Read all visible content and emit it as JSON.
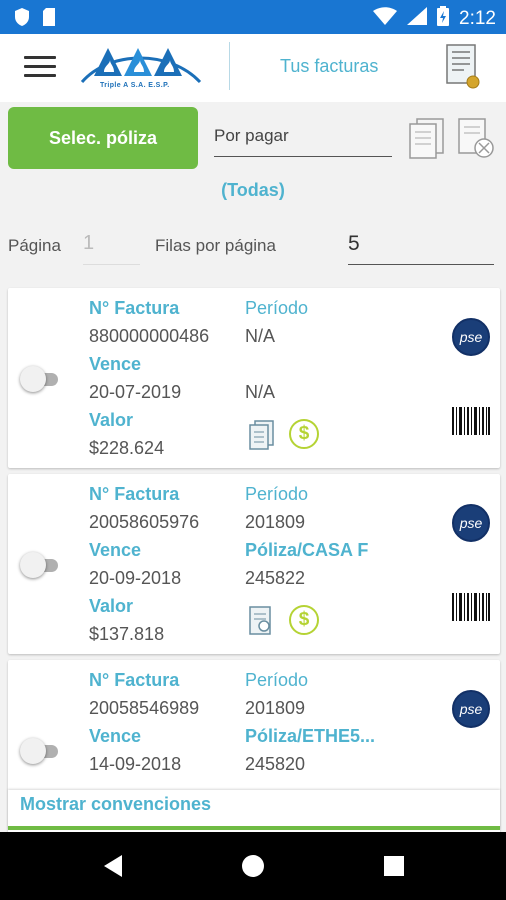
{
  "status_bar": {
    "time": "2:12"
  },
  "header": {
    "logo_caption": "Triple A S.A. E.S.P.",
    "title": "Tus facturas"
  },
  "toolbar": {
    "select_policy_label": "Selec. póliza",
    "filter_value": "Por pagar",
    "filter_subtitle": "(Todas)"
  },
  "pagination": {
    "page_label": "Página",
    "page_value": "1",
    "rows_label": "Filas por página",
    "rows_value": "5"
  },
  "labels": {
    "invoice_number": "N° Factura",
    "due": "Vence",
    "amount": "Valor",
    "period": "Período"
  },
  "invoices": [
    {
      "number": "880000000486",
      "due_date": "20-07-2019",
      "amount": "$228.624",
      "period": "N/A",
      "policy_label": "",
      "policy": "N/A",
      "pse": "pse"
    },
    {
      "number": "20058605976",
      "due_date": "20-09-2018",
      "amount": "$137.818",
      "period": "201809",
      "policy_label": "Póliza/CASA F",
      "policy": "245822",
      "pse": "pse"
    },
    {
      "number": "20058546989",
      "due_date": "14-09-2018",
      "amount": "",
      "period": "201809",
      "policy_label": "Póliza/ETHE5...",
      "policy": "245820",
      "pse": "pse"
    }
  ],
  "footer": {
    "show_conventions": "Mostrar convenciones"
  },
  "colors": {
    "accent": "#4fb3cf",
    "primary": "#6fbb44",
    "status_bar": "#1976d2",
    "pse": "#1a3e78"
  }
}
